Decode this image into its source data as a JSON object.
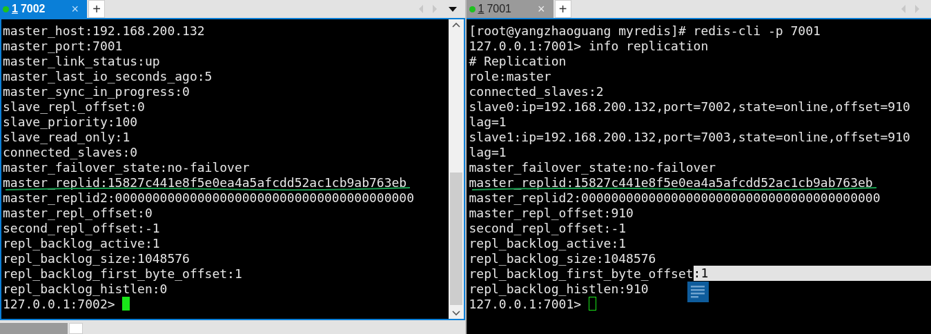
{
  "panes": [
    {
      "focused": true,
      "tab": {
        "number": "1",
        "label": "7002",
        "selected": true,
        "connected": true
      },
      "add_label": "+",
      "close_label": "×",
      "cursor_filled": true,
      "lines": [
        {
          "text": "master_host:192.168.200.132"
        },
        {
          "text": "master_port:7001"
        },
        {
          "text": "master_link_status:up"
        },
        {
          "text": "master_last_io_seconds_ago:5"
        },
        {
          "text": "master_sync_in_progress:0"
        },
        {
          "text": "slave_repl_offset:0"
        },
        {
          "text": "slave_priority:100"
        },
        {
          "text": "slave_read_only:1"
        },
        {
          "text": "connected_slaves:0"
        },
        {
          "text": "master_failover_state:no-failover"
        },
        {
          "text": "master_replid:15827c441e8f5e0ea4a5afcdd52ac1cb9ab763eb",
          "underlined": true
        },
        {
          "text": "master_replid2:0000000000000000000000000000000000000000"
        },
        {
          "text": "master_repl_offset:0"
        },
        {
          "text": "second_repl_offset:-1"
        },
        {
          "text": "repl_backlog_active:1"
        },
        {
          "text": "repl_backlog_size:1048576"
        },
        {
          "text": "repl_backlog_first_byte_offset:1"
        },
        {
          "text": "repl_backlog_histlen:0"
        },
        {
          "text": "127.0.0.1:7002> ",
          "prompt": true
        }
      ]
    },
    {
      "focused": false,
      "tab": {
        "number": "1",
        "label": "7001",
        "selected": false,
        "connected": true
      },
      "add_label": "+",
      "close_label": "×",
      "cursor_filled": false,
      "lines": [
        {
          "text": "[root@yangzhaoguang myredis]# redis-cli -p 7001"
        },
        {
          "text": "127.0.0.1:7001> info replication"
        },
        {
          "text": "# Replication"
        },
        {
          "text": "role:master"
        },
        {
          "text": "connected_slaves:2"
        },
        {
          "text": "slave0:ip=192.168.200.132,port=7002,state=online,offset=910"
        },
        {
          "text": "lag=1"
        },
        {
          "text": "slave1:ip=192.168.200.132,port=7003,state=online,offset=910"
        },
        {
          "text": "lag=1"
        },
        {
          "text": "master_failover_state:no-failover"
        },
        {
          "text": "master_replid:15827c441e8f5e0ea4a5afcdd52ac1cb9ab763eb",
          "underlined": true
        },
        {
          "text": "master_replid2:0000000000000000000000000000000000000000"
        },
        {
          "text": "master_repl_offset:910"
        },
        {
          "text": "second_repl_offset:-1"
        },
        {
          "text": "repl_backlog_active:1"
        },
        {
          "text": "repl_backlog_size:1048576"
        },
        {
          "text": "repl_backlog_first_byte_offset",
          "selected_text": ":1"
        },
        {
          "text": "repl_backlog_histlen:910",
          "note_icon": true
        },
        {
          "text": "127.0.0.1:7001> ",
          "prompt": true
        }
      ]
    }
  ]
}
